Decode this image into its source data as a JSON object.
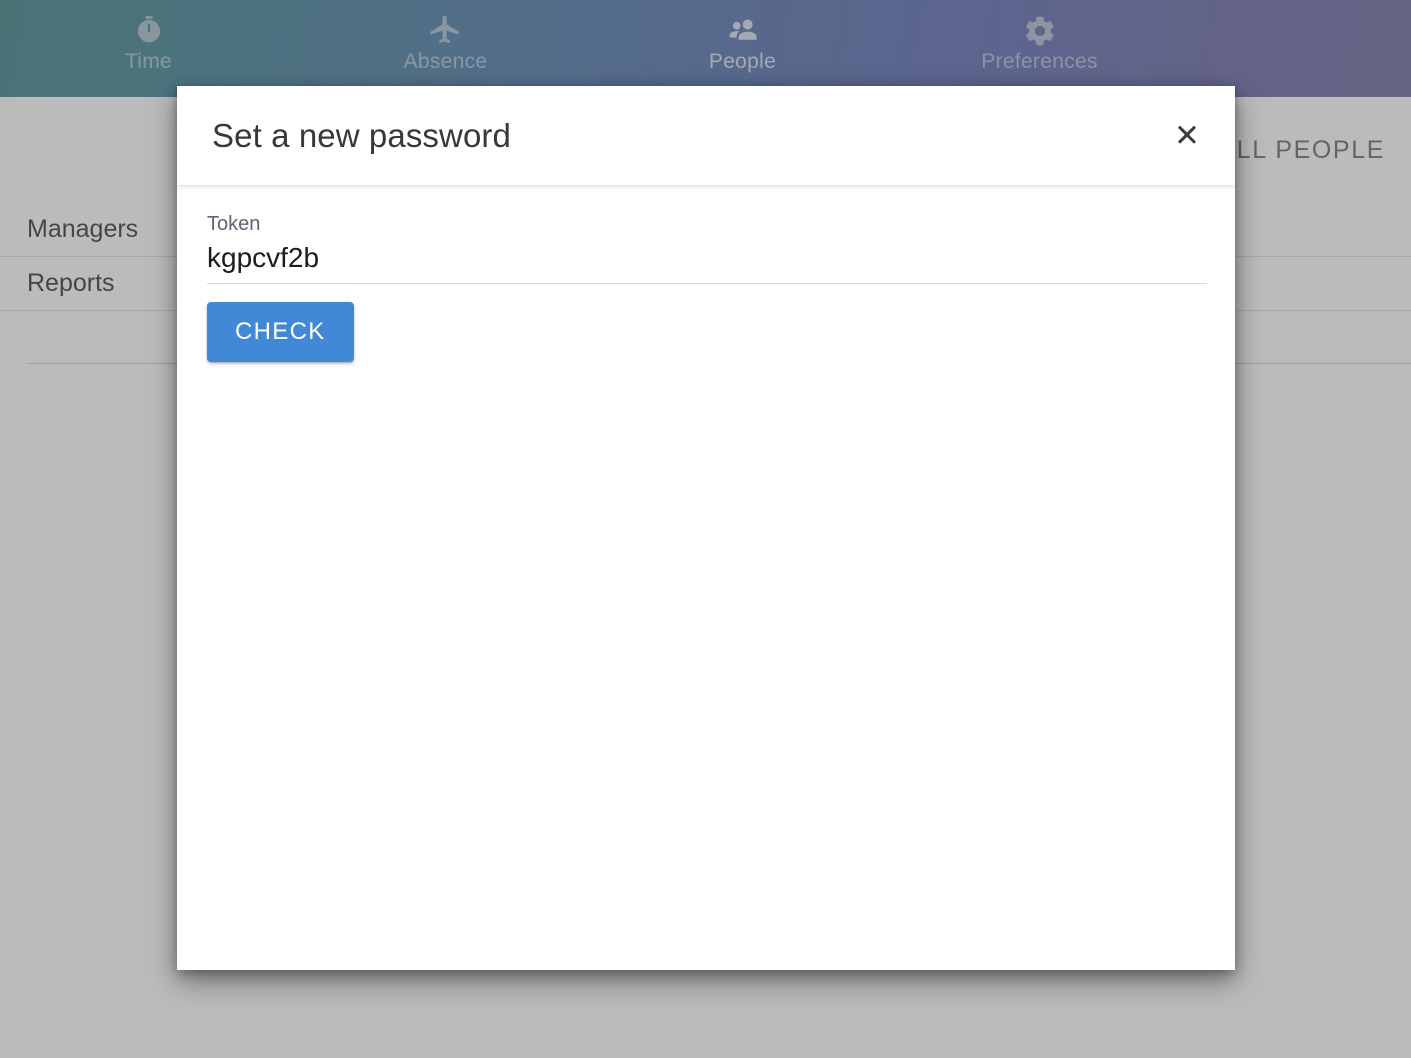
{
  "nav": {
    "items": [
      {
        "label": "Time",
        "icon": "stopwatch-icon",
        "active": false
      },
      {
        "label": "Absence",
        "icon": "airplane-icon",
        "active": false
      },
      {
        "label": "People",
        "icon": "people-icon",
        "active": true
      },
      {
        "label": "Preferences",
        "icon": "gear-icon",
        "active": false
      }
    ]
  },
  "page": {
    "toolbar": {
      "all_people_label": "ALL PEOPLE"
    },
    "list": {
      "rows": [
        {
          "label": "Managers"
        },
        {
          "label": "Reports"
        }
      ]
    }
  },
  "modal": {
    "title": "Set a new password",
    "close_label": "✕",
    "close_icon": "close-icon",
    "token": {
      "label": "Token",
      "value": "kgpcvf2b",
      "placeholder": "Token"
    },
    "check_button": "CHECK"
  },
  "colors": {
    "nav_gradient_start": "#146a70",
    "nav_gradient_mid": "#2f549f",
    "nav_gradient_end": "#4d4a8e",
    "primary_button": "#4189d6",
    "title_text": "#383838",
    "label_text": "#5d6672",
    "overlay": "#7d7d7d"
  }
}
